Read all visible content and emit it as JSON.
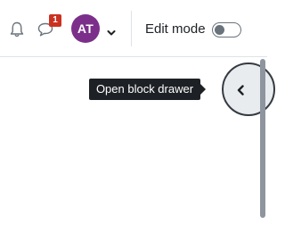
{
  "navbar": {
    "notifications_icon": "bell-icon",
    "messages_icon": "chat-bubble-icon",
    "messages_badge": "1",
    "avatar_initials": "AT",
    "avatar_color": "#7b2f8a",
    "user_menu_icon": "chevron-down-icon",
    "edit_mode_label": "Edit mode",
    "edit_mode_on": false
  },
  "block_drawer": {
    "tooltip": "Open block drawer",
    "toggle_icon": "chevron-left-icon"
  }
}
